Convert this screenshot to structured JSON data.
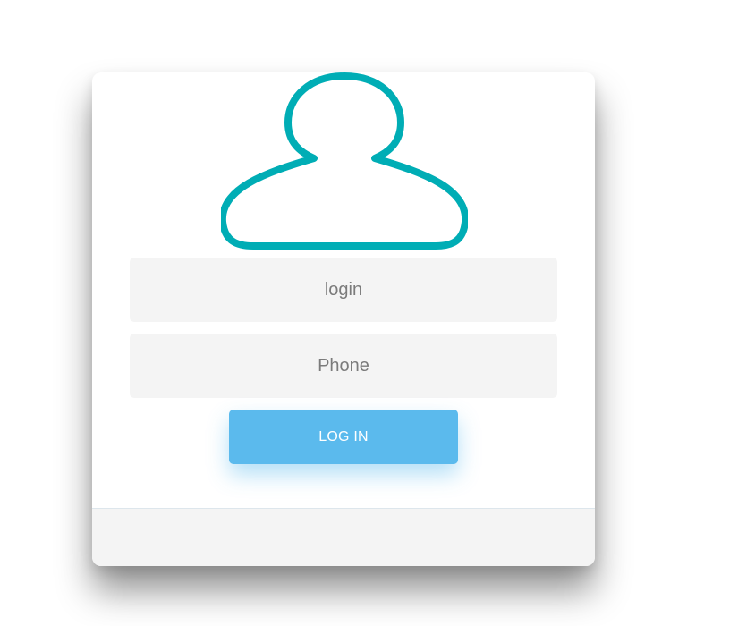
{
  "form": {
    "login_placeholder": "login",
    "phone_placeholder": "Phone",
    "login_button_label": "LOG IN"
  },
  "icons": {
    "avatar": "user-avatar-icon"
  },
  "colors": {
    "avatar_outline": "#00adb5",
    "button": "#5bbaed",
    "field_background": "#f4f4f4",
    "footer_background": "#f4f4f4"
  }
}
